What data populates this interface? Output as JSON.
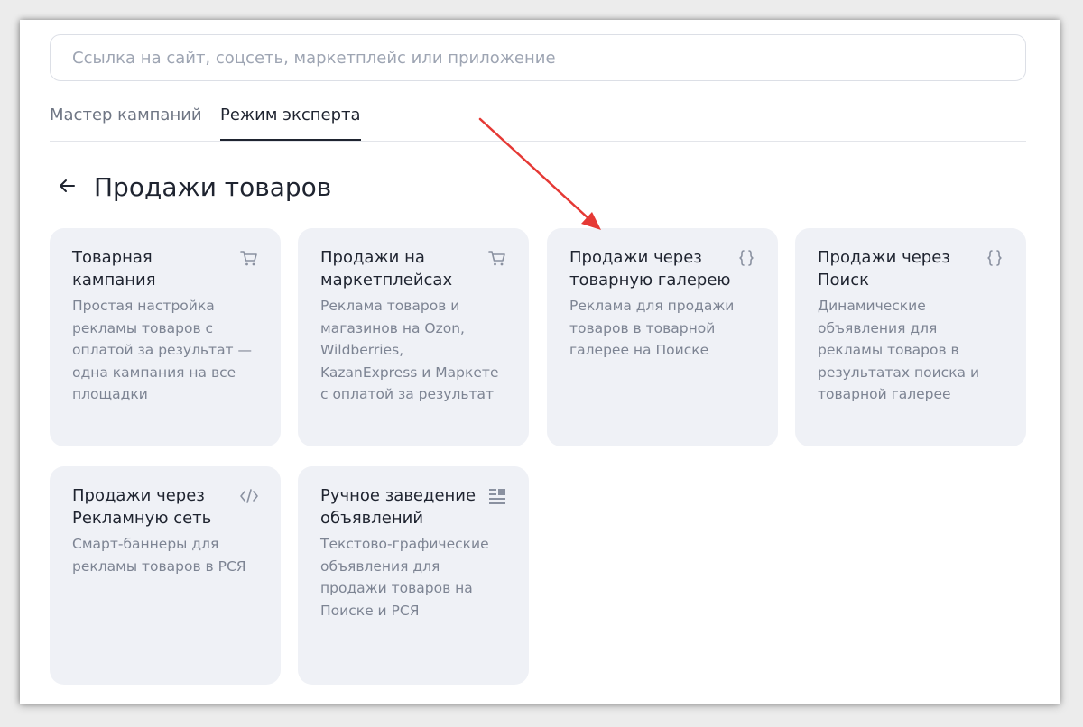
{
  "search": {
    "placeholder": "Ссылка на сайт, соцсеть, маркетплейс или приложение"
  },
  "tabs": [
    {
      "label": "Мастер кампаний",
      "active": false
    },
    {
      "label": "Режим эксперта",
      "active": true
    }
  ],
  "page": {
    "title": "Продажи товаров"
  },
  "cards": [
    {
      "title": "Товарная кампания",
      "description": "Простая настройка рекламы товаров с оплатой за результат — одна кампания на все площадки",
      "icon": "cart-icon"
    },
    {
      "title": "Продажи на маркетплейсах",
      "description": "Реклама товаров и магазинов на Ozon, Wildberries, KazanExpress и Маркете с оплатой за результат",
      "icon": "cart-icon"
    },
    {
      "title": "Продажи через товарную галерею",
      "description": "Реклама для продажи товаров в товарной галерее на Поиске",
      "icon": "braces-icon"
    },
    {
      "title": "Продажи через Поиск",
      "description": "Динамические объявления для рекламы товаров в результатах поиска и товарной галерее",
      "icon": "braces-icon"
    },
    {
      "title": "Продажи через Рекламную сеть",
      "description": "Смарт-баннеры для рекламы товаров в РСЯ",
      "icon": "code-icon"
    },
    {
      "title": "Ручное заведение объявлений",
      "description": "Текстово-графические объявления для продажи товаров на Поиске и РСЯ",
      "icon": "text-layout-icon"
    }
  ],
  "colors": {
    "card_bg": "#eff1f6",
    "title_text": "#1f2430",
    "muted_text": "#7d8493",
    "annotation_arrow": "#e53935"
  }
}
